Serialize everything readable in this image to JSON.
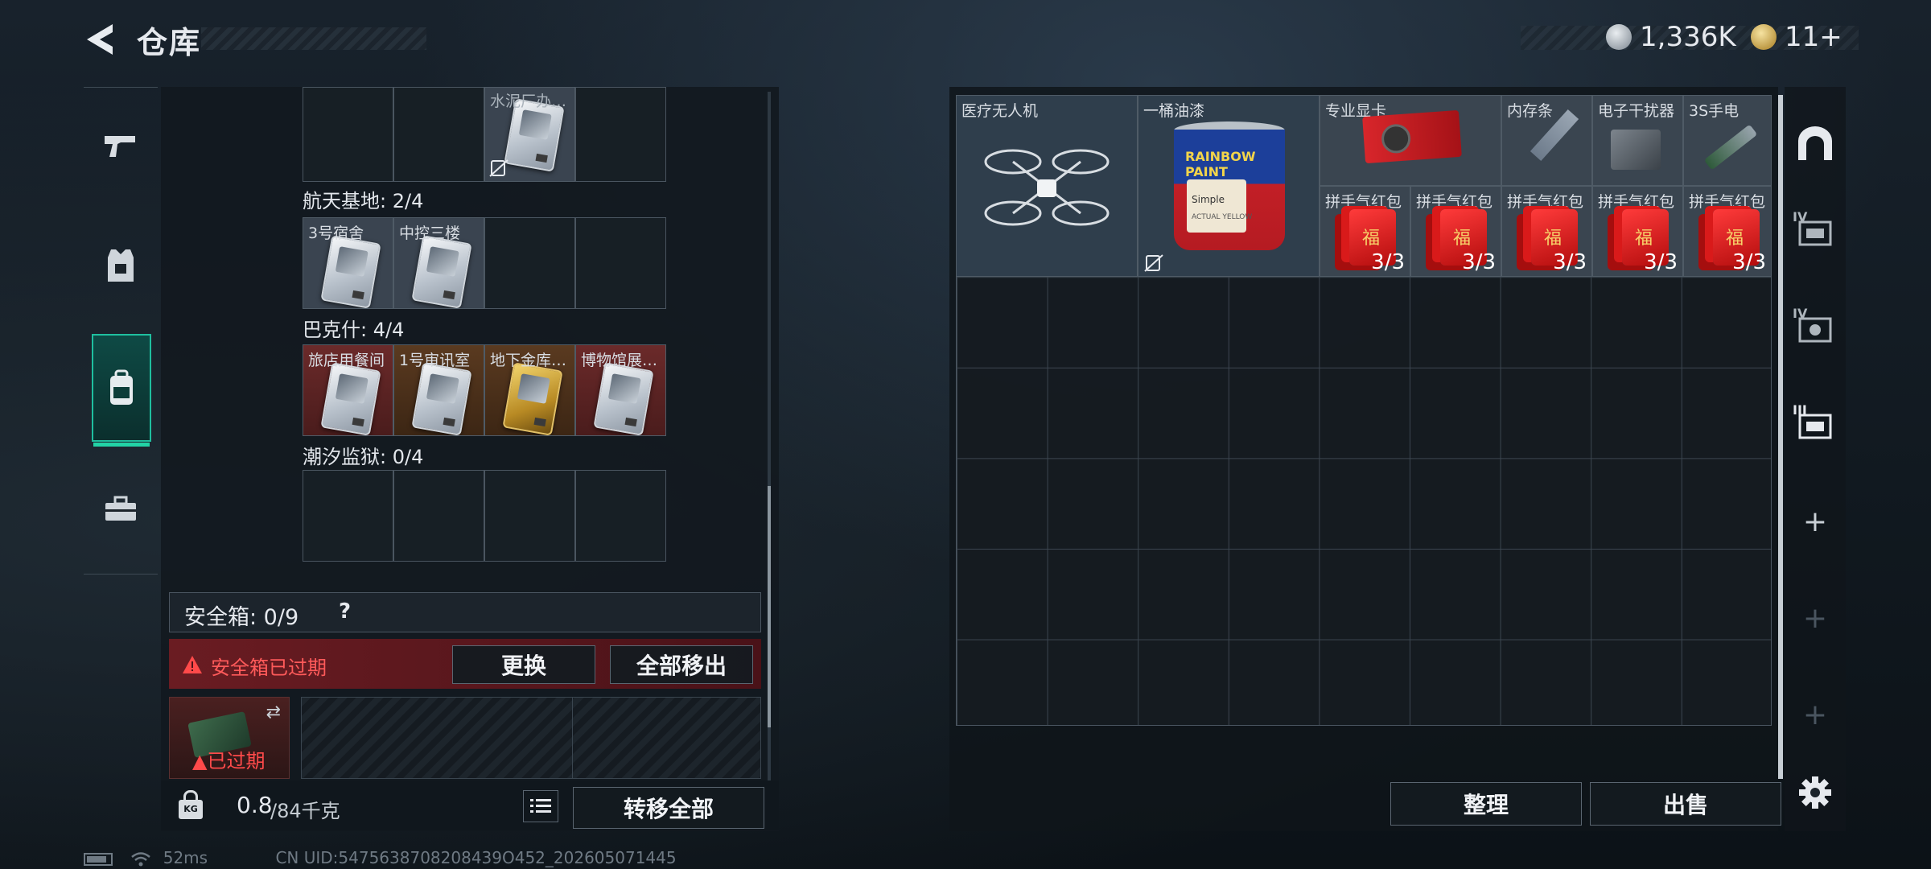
{
  "header": {
    "title": "仓库",
    "currency1_value": "1,336K",
    "currency2_value": "11",
    "currency2_plus": "+"
  },
  "left_nav": {
    "items": [
      {
        "name": "weapons",
        "icon": "pistol-icon"
      },
      {
        "name": "armor",
        "icon": "vest-icon"
      },
      {
        "name": "backpack",
        "icon": "backpack-icon",
        "active": true
      },
      {
        "name": "toolbox",
        "icon": "toolbox-icon"
      }
    ]
  },
  "keycards": {
    "top_partial": {
      "cards": [
        {
          "label": "水泥厂办…"
        }
      ]
    },
    "sections": [
      {
        "label": "航天基地: 2/4",
        "cards": [
          {
            "label": "3号宿舍"
          },
          {
            "label": "中控三楼"
          }
        ]
      },
      {
        "label": "巴克什: 4/4",
        "cards": [
          {
            "label": "旅店用餐间"
          },
          {
            "label": "1号审讯室"
          },
          {
            "label": "地下金库…"
          },
          {
            "label": "博物馆展…"
          }
        ]
      },
      {
        "label": "潮汐监狱: 0/4",
        "cards": []
      }
    ]
  },
  "safe_box": {
    "label": "安全箱: 0/9",
    "help": "?",
    "expired_warning": "安全箱已过期",
    "replace_button": "更换",
    "move_all_out_button": "全部移出",
    "expired_tag": "已过期"
  },
  "bottom_bar": {
    "weight_current": "0.8",
    "weight_max": "/84千克",
    "lock_badge": "KG",
    "transfer_all_button": "转移全部"
  },
  "storage": {
    "items": [
      {
        "label": "医疗无人机"
      },
      {
        "label": "一桶油漆",
        "paint_brand": "RAINBOW PAINT",
        "paint_sub1": "Simple",
        "paint_sub2": "ACTUAL YELLOW"
      },
      {
        "label": "专业显卡"
      },
      {
        "label": "内存条"
      },
      {
        "label": "电子干扰器"
      },
      {
        "label": "3S手电"
      },
      {
        "label": "拼手气红包",
        "count": "3/3"
      },
      {
        "label": "拼手气红包",
        "count": "3/3"
      },
      {
        "label": "拼手气红包",
        "count": "3/3"
      },
      {
        "label": "拼手气红包",
        "count": "3/3"
      },
      {
        "label": "拼手气红包",
        "count": "3/3"
      }
    ],
    "sort_button": "整理",
    "sell_button": "出售"
  },
  "right_sidebar": {
    "tab_labels": [
      "IV",
      "IV",
      "III"
    ],
    "plus": "+"
  },
  "status_bar": {
    "latency": "52ms",
    "uid": "CN UID:5475638708208439O452_202605071445"
  },
  "colors": {
    "accent": "#22d3a6",
    "warning_red": "#e53a3a",
    "expired_bg": "#5a1c22"
  }
}
